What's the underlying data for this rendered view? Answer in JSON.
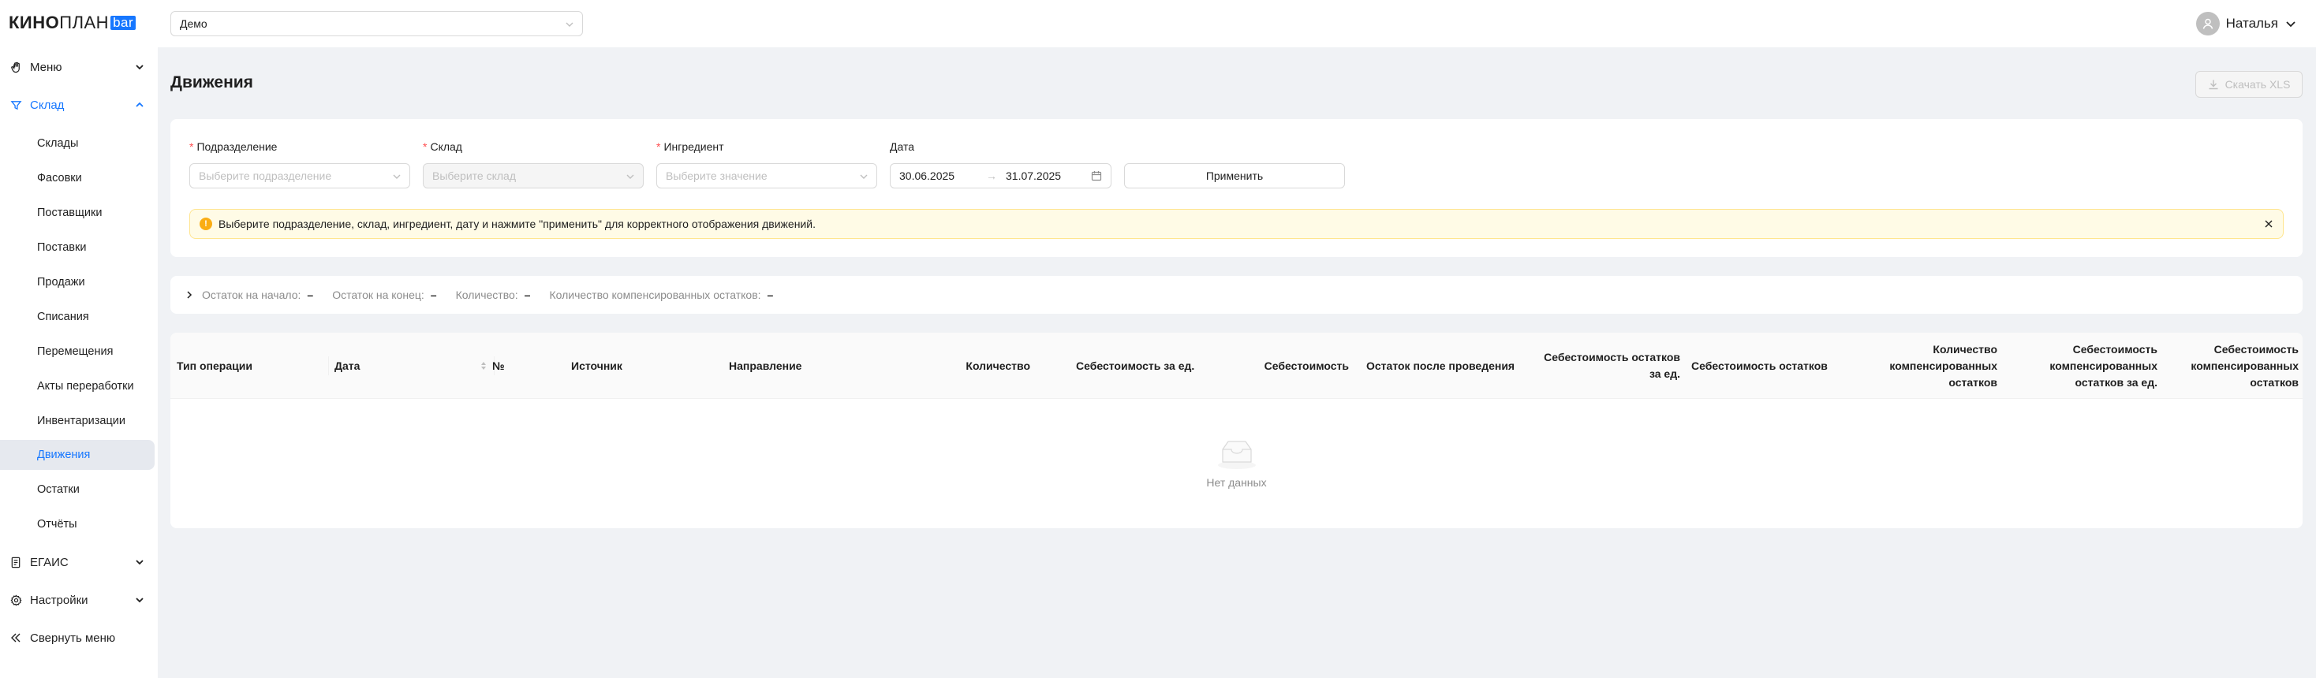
{
  "app": {
    "logo_kino": "КИНО",
    "logo_plan": "ПЛАН",
    "logo_bar": "bar"
  },
  "sidebar": {
    "menu": {
      "label": "Меню",
      "icon": "hand-icon"
    },
    "sklad": {
      "label": "Склад",
      "icon": "filter-icon"
    },
    "sklad_items": [
      {
        "label": "Склады"
      },
      {
        "label": "Фасовки"
      },
      {
        "label": "Поставщики"
      },
      {
        "label": "Поставки"
      },
      {
        "label": "Продажи"
      },
      {
        "label": "Списания"
      },
      {
        "label": "Перемещения"
      },
      {
        "label": "Акты переработки"
      },
      {
        "label": "Инвентаризации"
      },
      {
        "label": "Движения"
      },
      {
        "label": "Остатки"
      },
      {
        "label": "Отчёты"
      }
    ],
    "active_item": "Движения",
    "egais": {
      "label": "ЕГАИС",
      "icon": "document-icon"
    },
    "settings": {
      "label": "Настройки",
      "icon": "gear-icon"
    },
    "collapse": {
      "label": "Свернуть меню",
      "icon": "double-chevron-left-icon"
    }
  },
  "topbar": {
    "cinema_select": "Демо",
    "user_name": "Наталья"
  },
  "page": {
    "title": "Движения",
    "download_xls": "Скачать XLS"
  },
  "filters": {
    "subdivision": {
      "label": "Подразделение",
      "placeholder": "Выберите подразделение",
      "required": true
    },
    "warehouse": {
      "label": "Склад",
      "placeholder": "Выберите склад",
      "required": true,
      "disabled": true
    },
    "ingredient": {
      "label": "Ингредиент",
      "placeholder": "Выберите значение",
      "required": true
    },
    "date": {
      "label": "Дата",
      "from": "30.06.2025",
      "to": "31.07.2025"
    },
    "apply_label": "Применить",
    "required_mark": "*"
  },
  "alert": {
    "text": "Выберите подразделение, склад, ингредиент, дату и нажмите \"применить\" для корректного отображения движений.",
    "type": "warning"
  },
  "summary": {
    "start_label": "Остаток на начало:",
    "start_value": "–",
    "end_label": "Остаток на конец:",
    "end_value": "–",
    "qty_label": "Количество:",
    "qty_value": "–",
    "comp_label": "Количество компенсированных остатков:",
    "comp_value": "–"
  },
  "table": {
    "columns": [
      "Тип операции",
      "Дата",
      "№",
      "Источник",
      "Направление",
      "Количество",
      "Себестоимость за ед.",
      "Себестоимость",
      "Остаток после проведения",
      "Себестоимость остатков за ед.",
      "Себестоимость остатков",
      "Количество компенсированных остатков",
      "Себестоимость компенсированных остатков за ед.",
      "Себестоимость компенсированных остатков"
    ],
    "rows": [],
    "empty_text": "Нет данных"
  },
  "colors": {
    "accent": "#1677ff",
    "required": "#ff4d4f",
    "warning_bg": "#fffbe6",
    "warning_icon": "#faad14",
    "page_bg": "#f0f2f5"
  }
}
